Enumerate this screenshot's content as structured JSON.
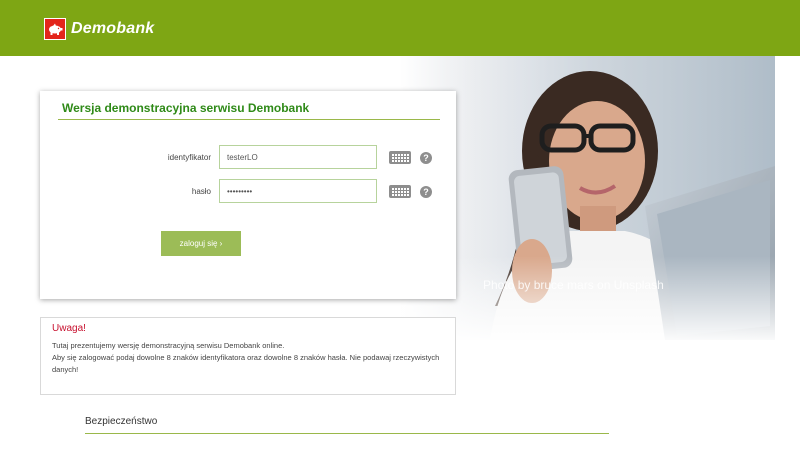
{
  "header": {
    "brand": "Demobank",
    "logo_icon": "piggy-bank-icon",
    "bar_color": "#7ea614",
    "logo_color": "#e3251b"
  },
  "hero": {
    "photo_credit": "Photo by bruce mars on Unsplash"
  },
  "login": {
    "title": "Wersja demonstracyjna serwisu Demobank",
    "id_label": "identyfikator",
    "id_value": "testerLO",
    "password_label": "hasło",
    "password_value": "•••••••••",
    "keyboard_icon": "keyboard-icon",
    "help_glyph": "?",
    "submit_label": "zaloguj się ›",
    "accent": "#2f8a18",
    "button_color": "#9cbc57"
  },
  "warning": {
    "title": "Uwaga!",
    "line1": "Tutaj prezentujemy wersję demonstracyjną serwisu Demobank online.",
    "line2": "Aby się zalogować podaj dowolne 8 znaków identyfikatora oraz dowolne 8 znaków hasła. Nie podawaj rzeczywistych danych!",
    "title_color": "#c8102e"
  },
  "footer": {
    "security_heading": "Bezpieczeństwo"
  }
}
